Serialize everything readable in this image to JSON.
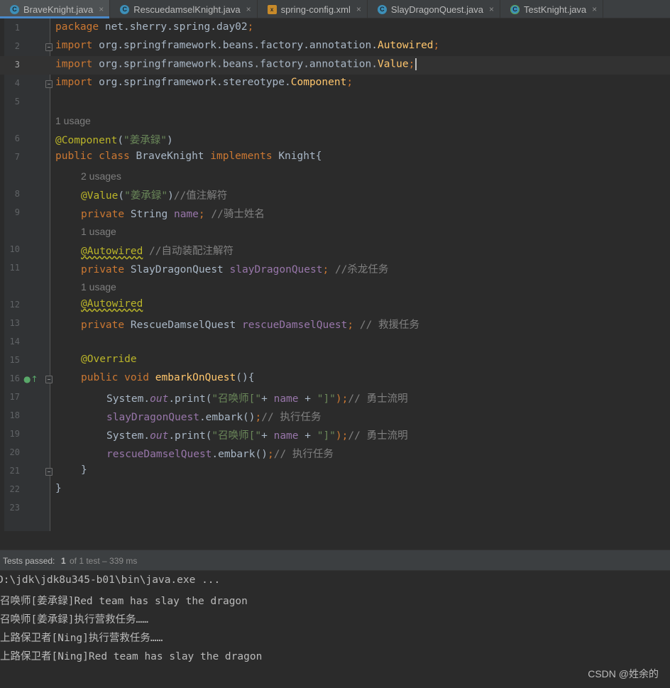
{
  "tabs": [
    {
      "label": "BraveKnight.java",
      "icon": "java-class-icon",
      "active": true
    },
    {
      "label": "RescuedamselKnight.java",
      "icon": "java-class-icon",
      "active": false
    },
    {
      "label": "spring-config.xml",
      "icon": "xml-file-icon",
      "active": false
    },
    {
      "label": "SlayDragonQuest.java",
      "icon": "java-class-icon",
      "active": false
    },
    {
      "label": "TestKnight.java",
      "icon": "test-class-icon",
      "active": false
    }
  ],
  "tab_close": "×",
  "editor": {
    "line_numbers": [
      "1",
      "2",
      "3",
      "4",
      "5",
      "6",
      "7",
      "8",
      "9",
      "10",
      "11",
      "12",
      "13",
      "14",
      "15",
      "16",
      "17",
      "18",
      "19",
      "20",
      "21",
      "22",
      "23"
    ],
    "hints": [
      "1 usage",
      "2 usages",
      "1 usage",
      "1 usage",
      "1 usage"
    ],
    "code": {
      "l1": [
        "package",
        "net.sherry.spring.day02",
        ";"
      ],
      "l2": [
        "import",
        "org.springframework.beans.factory.annotation.",
        "Autowired",
        ";"
      ],
      "l3": [
        "import",
        "org.springframework.beans.factory.annotation.",
        "Value",
        ";"
      ],
      "l4": [
        "import",
        "org.springframework.stereotype.",
        "Component",
        ";"
      ],
      "l6": [
        "@Component",
        "(",
        "\"姜承録\"",
        ")"
      ],
      "l7": [
        "public class",
        "BraveKnight",
        "implements",
        "Knight{"
      ],
      "l8": [
        "@Value",
        "(",
        "\"姜承録\"",
        ")",
        "//值注解符"
      ],
      "l9": [
        "private",
        "String",
        "name",
        ";",
        "//骑士姓名"
      ],
      "l10": [
        "@Autowired",
        "//自动装配注解符"
      ],
      "l11": [
        "private",
        "SlayDragonQuest",
        "slayDragonQuest",
        ";",
        "//杀龙任务"
      ],
      "l12": [
        "@Autowired"
      ],
      "l13": [
        "private",
        "RescueDamselQuest",
        "rescueDamselQuest",
        ";",
        "// 救援任务"
      ],
      "l15": [
        "@Override"
      ],
      "l16": [
        "public void",
        "embarkOnQuest",
        "(){"
      ],
      "l17": [
        "System.",
        "out",
        ".print(",
        "\"召唤师[\"",
        "+",
        "name",
        "+",
        "\"]\"",
        ");",
        "// 勇士流明"
      ],
      "l18": [
        "slayDragonQuest",
        ".embark()",
        ";",
        "// 执行任务"
      ],
      "l19": [
        "System.",
        "out",
        ".print(",
        "\"召唤师[\"",
        "+",
        "name",
        "+",
        "\"]\"",
        ");",
        "// 勇士流明"
      ],
      "l20": [
        "rescueDamselQuest",
        ".embark()",
        ";",
        "// 执行任务"
      ],
      "l21": [
        "}"
      ],
      "l22": [
        "}"
      ]
    }
  },
  "run": {
    "status_bold": "Tests passed:",
    "status_count": "1",
    "status_rest": "of 1 test – 339 ms",
    "console_lines": [
      "D:\\jdk\\jdk8u345-b01\\bin\\java.exe ...",
      "召唤师[姜承録]Red team has slay the dragon",
      "召唤师[姜承録]执行营救任务……",
      "上路保卫者[Ning]执行营救任务……",
      "上路保卫者[Ning]Red team has slay the dragon"
    ]
  },
  "watermark": "CSDN @姓余的",
  "colors": {
    "background": "#2b2b2b",
    "keyword": "#cc7832",
    "annotation": "#bbb529",
    "string": "#6a8759",
    "field": "#9876aa",
    "comment": "#808080",
    "method": "#ffc66d",
    "active_tab_accent": "#4a88c7"
  }
}
